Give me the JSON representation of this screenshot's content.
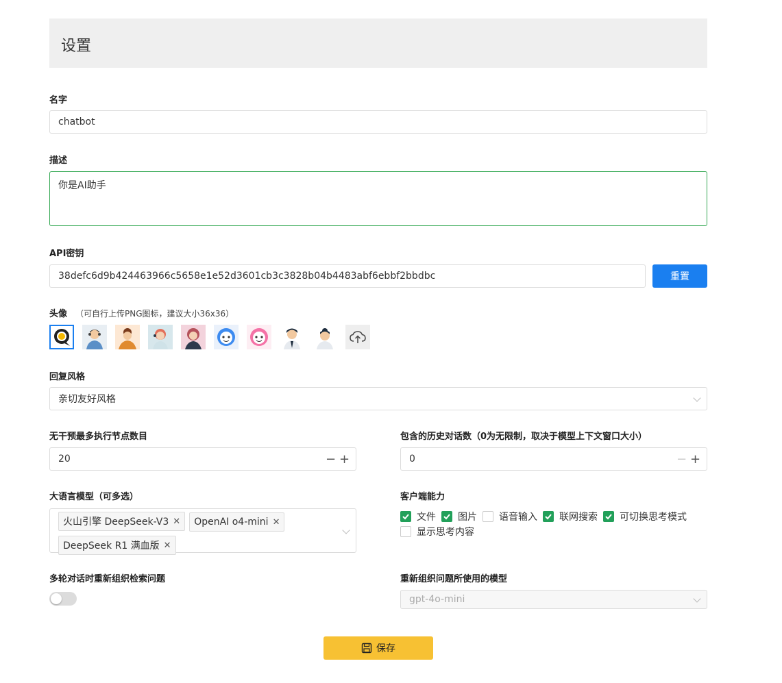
{
  "page": {
    "title": "设置"
  },
  "name_field": {
    "label": "名字",
    "value": "chatbot"
  },
  "description_field": {
    "label": "描述",
    "value": "你是AI助手"
  },
  "api_key": {
    "label": "API密钥",
    "value": "38defc6d9b424463966c5658e1e52d3601cb3c3828b04b4483abf6ebbf2bbdbc",
    "reset_label": "重置"
  },
  "avatar": {
    "label": "头像",
    "hint": "（可自行上传PNG图标，建议大小36x36）",
    "items": [
      "chat-bubble-avatar",
      "agent-male-avatar",
      "agent-female-curly-avatar",
      "agent-female-headset-avatar",
      "agent-female-pink-avatar",
      "robot-blue-avatar",
      "robot-pink-avatar",
      "man-business-avatar",
      "woman-business-avatar"
    ],
    "selected_index": 0,
    "upload_icon": "cloud-upload-icon"
  },
  "reply_style": {
    "label": "回复风格",
    "value": "亲切友好风格"
  },
  "max_nodes": {
    "label": "无干预最多执行节点数目",
    "value": "20"
  },
  "history_count": {
    "label": "包含的历史对话数（0为无限制，取决于模型上下文窗口大小）",
    "value": "0"
  },
  "llm": {
    "label": "大语言模型（可多选）",
    "tags": [
      "火山引擎 DeepSeek-V3",
      "OpenAI o4-mini",
      "DeepSeek R1 满血版"
    ]
  },
  "client": {
    "label": "客户端能力",
    "options": [
      {
        "label": "文件",
        "checked": true
      },
      {
        "label": "图片",
        "checked": true
      },
      {
        "label": "语音输入",
        "checked": false
      },
      {
        "label": "联网搜索",
        "checked": true
      },
      {
        "label": "可切换思考模式",
        "checked": true
      },
      {
        "label": "显示思考内容",
        "checked": false
      }
    ]
  },
  "rewrite": {
    "label": "多轮对话时重新组织检索问题",
    "enabled": false
  },
  "rewrite_model": {
    "label": "重新组织问题所使用的模型",
    "placeholder": "gpt-4o-mini"
  },
  "save_label": "保存",
  "colors": {
    "primary": "#1a7ff0",
    "save": "#f7c133",
    "check": "#22a05a"
  }
}
